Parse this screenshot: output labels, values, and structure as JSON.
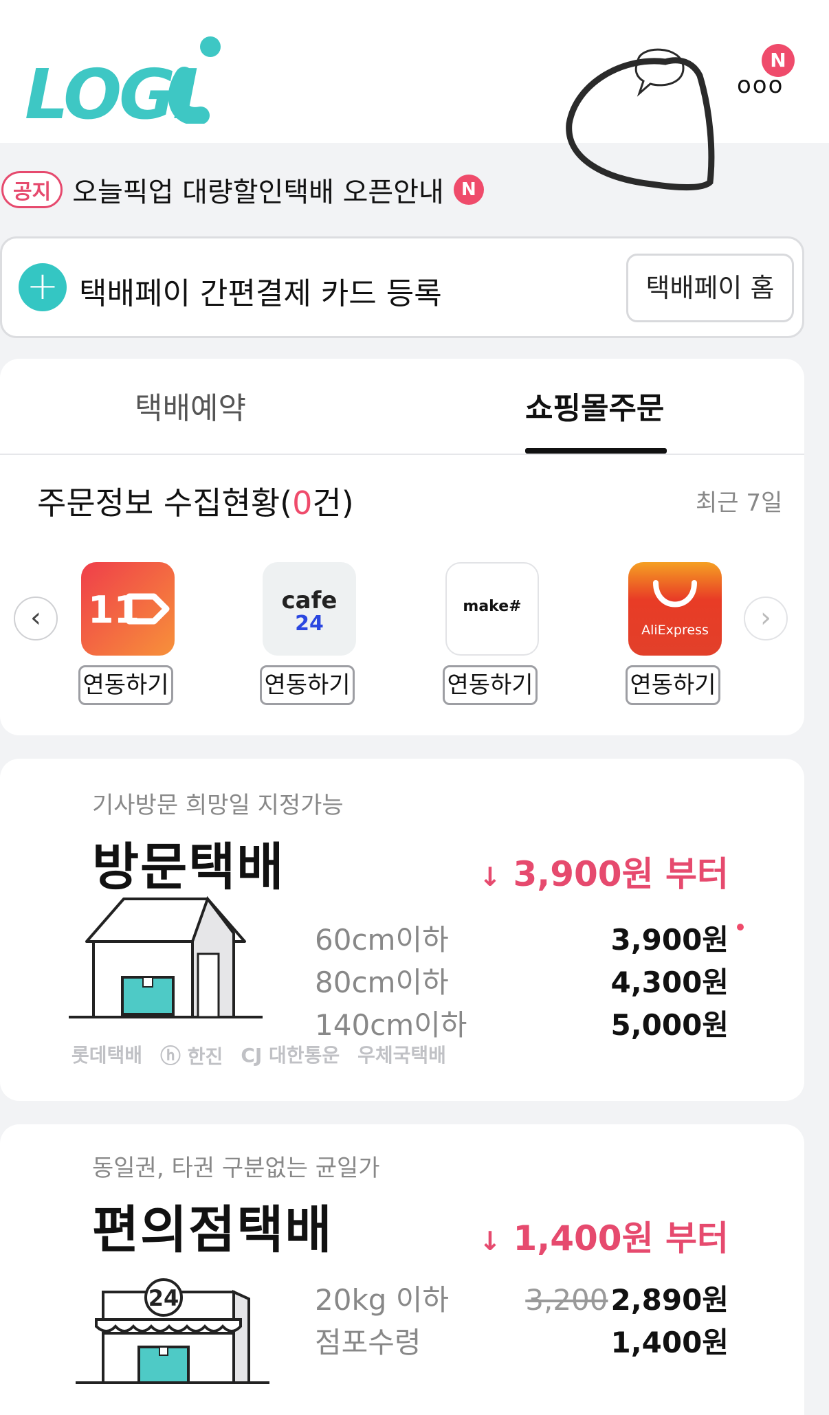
{
  "header": {
    "logo_text": "LOGI",
    "notification_badge": "N"
  },
  "notice": {
    "tag": "공지",
    "text": "오늘픽업 대량할인택배 오픈안내",
    "badge": "N"
  },
  "pay": {
    "register_text": "택배페이 간편결제 카드 등록",
    "home_button": "택배페이 홈"
  },
  "tabs": {
    "booking": "택배예약",
    "shopping": "쇼핑몰주문"
  },
  "orders": {
    "title_prefix": "주문정보 수집현황(",
    "count": "0",
    "title_suffix": "건)",
    "period": "최근 7일",
    "connect_label": "연동하기",
    "malls": [
      {
        "name": "11번가",
        "logo_text": "11"
      },
      {
        "name": "cafe24",
        "logo_text_top": "cafe",
        "logo_text_bottom": "24"
      },
      {
        "name": "make#",
        "logo_text": "make#"
      },
      {
        "name": "AliExpress",
        "logo_text": "AliExpress"
      }
    ]
  },
  "visit": {
    "subtitle": "기사방문 희망일 지정가능",
    "title": "방문택배",
    "from_price": "3,900원 부터",
    "rows": [
      {
        "label": "60cm이하",
        "price": "3,900원"
      },
      {
        "label": "80cm이하",
        "price": "4,300원"
      },
      {
        "label": "140cm이하",
        "price": "5,000원"
      }
    ],
    "carriers": [
      "롯데택배",
      "한진",
      "CJ 대한통운",
      "우체국택배"
    ]
  },
  "cvs": {
    "subtitle": "동일권, 타권 구분없는 균일가",
    "title": "편의점택배",
    "from_price": "1,400원 부터",
    "store_number": "24",
    "rows": [
      {
        "label": "20kg 이하",
        "old_price": "3,200",
        "price": "2,890원"
      },
      {
        "label": "점포수령",
        "price": "1,400원"
      }
    ]
  },
  "colors": {
    "brand_teal": "#34c6c3",
    "accent_pink": "#e64a6e"
  }
}
